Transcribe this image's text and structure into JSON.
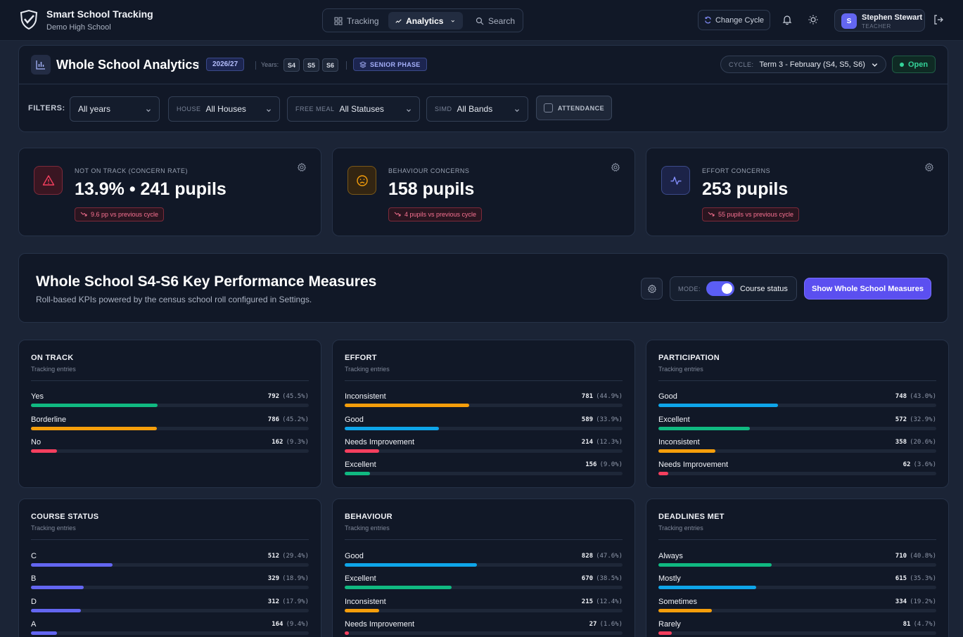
{
  "app": {
    "title": "Smart School Tracking",
    "school": "Demo High School"
  },
  "nav": {
    "tracking": "Tracking",
    "analytics": "Analytics",
    "search": "Search"
  },
  "topbar": {
    "change_cycle": "Change Cycle",
    "user_name": "Stephen Stewart",
    "user_role": "TEACHER",
    "user_initial": "S"
  },
  "header": {
    "title": "Whole School Analytics",
    "session": "2026/27",
    "years_label": "Years:",
    "years": [
      "S4",
      "S5",
      "S6"
    ],
    "phase": "SENIOR PHASE",
    "cycle_label": "CYCLE:",
    "cycle_value": "Term 3 - February (S4, S5, S6)",
    "status": "Open"
  },
  "filters": {
    "label": "FILTERS:",
    "years": {
      "value": "All years"
    },
    "house": {
      "key": "HOUSE",
      "value": "All Houses"
    },
    "free_meal": {
      "key": "FREE MEAL",
      "value": "All Statuses"
    },
    "simd": {
      "key": "SIMD",
      "value": "All Bands"
    },
    "attendance": "ATTENDANCE"
  },
  "stats": [
    {
      "label": "NOT ON TRACK (CONCERN RATE)",
      "value": "13.9% • 241 pupils",
      "delta": "9.6 pp vs previous cycle",
      "icon": "alert-triangle-icon",
      "color": "#f43f5e"
    },
    {
      "label": "BEHAVIOUR CONCERNS",
      "value": "158 pupils",
      "delta": "4 pupils vs previous cycle",
      "icon": "frown-face-icon",
      "color": "#f59e0b"
    },
    {
      "label": "EFFORT CONCERNS",
      "value": "253 pupils",
      "delta": "55 pupils vs previous cycle",
      "icon": "activity-pulse-icon",
      "color": "#818cf8"
    }
  ],
  "kpi": {
    "title": "Whole School S4-S6 Key Performance Measures",
    "subtitle": "Roll-based KPIs powered by the census school roll configured in Settings.",
    "mode_label": "MODE:",
    "mode_value": "Course status",
    "show_button": "Show Whole School Measures"
  },
  "measures": [
    {
      "title": "ON TRACK",
      "subtitle": "Tracking entries",
      "rows": [
        {
          "label": "Yes",
          "count": "792",
          "pct": "(45.5%)",
          "frac": 0.455,
          "color": "#10b981"
        },
        {
          "label": "Borderline",
          "count": "786",
          "pct": "(45.2%)",
          "frac": 0.452,
          "color": "#f59e0b"
        },
        {
          "label": "No",
          "count": "162",
          "pct": "(9.3%)",
          "frac": 0.093,
          "color": "#f43f5e"
        }
      ]
    },
    {
      "title": "EFFORT",
      "subtitle": "Tracking entries",
      "rows": [
        {
          "label": "Inconsistent",
          "count": "781",
          "pct": "(44.9%)",
          "frac": 0.449,
          "color": "#f59e0b"
        },
        {
          "label": "Good",
          "count": "589",
          "pct": "(33.9%)",
          "frac": 0.339,
          "color": "#0ea5e9"
        },
        {
          "label": "Needs Improvement",
          "count": "214",
          "pct": "(12.3%)",
          "frac": 0.123,
          "color": "#f43f5e"
        },
        {
          "label": "Excellent",
          "count": "156",
          "pct": "(9.0%)",
          "frac": 0.09,
          "color": "#10b981"
        }
      ]
    },
    {
      "title": "PARTICIPATION",
      "subtitle": "Tracking entries",
      "rows": [
        {
          "label": "Good",
          "count": "748",
          "pct": "(43.0%)",
          "frac": 0.43,
          "color": "#0ea5e9"
        },
        {
          "label": "Excellent",
          "count": "572",
          "pct": "(32.9%)",
          "frac": 0.329,
          "color": "#10b981"
        },
        {
          "label": "Inconsistent",
          "count": "358",
          "pct": "(20.6%)",
          "frac": 0.206,
          "color": "#f59e0b"
        },
        {
          "label": "Needs Improvement",
          "count": "62",
          "pct": "(3.6%)",
          "frac": 0.036,
          "color": "#f43f5e"
        }
      ]
    },
    {
      "title": "COURSE STATUS",
      "subtitle": "Tracking entries",
      "rows": [
        {
          "label": "C",
          "count": "512",
          "pct": "(29.4%)",
          "frac": 0.294,
          "color": "#6366f1"
        },
        {
          "label": "B",
          "count": "329",
          "pct": "(18.9%)",
          "frac": 0.189,
          "color": "#6366f1"
        },
        {
          "label": "D",
          "count": "312",
          "pct": "(17.9%)",
          "frac": 0.179,
          "color": "#6366f1"
        },
        {
          "label": "A",
          "count": "164",
          "pct": "(9.4%)",
          "frac": 0.094,
          "color": "#6366f1"
        }
      ]
    },
    {
      "title": "BEHAVIOUR",
      "subtitle": "Tracking entries",
      "rows": [
        {
          "label": "Good",
          "count": "828",
          "pct": "(47.6%)",
          "frac": 0.476,
          "color": "#0ea5e9"
        },
        {
          "label": "Excellent",
          "count": "670",
          "pct": "(38.5%)",
          "frac": 0.385,
          "color": "#10b981"
        },
        {
          "label": "Inconsistent",
          "count": "215",
          "pct": "(12.4%)",
          "frac": 0.124,
          "color": "#f59e0b"
        },
        {
          "label": "Needs Improvement",
          "count": "27",
          "pct": "(1.6%)",
          "frac": 0.016,
          "color": "#f43f5e"
        }
      ]
    },
    {
      "title": "DEADLINES MET",
      "subtitle": "Tracking entries",
      "rows": [
        {
          "label": "Always",
          "count": "710",
          "pct": "(40.8%)",
          "frac": 0.408,
          "color": "#10b981"
        },
        {
          "label": "Mostly",
          "count": "615",
          "pct": "(35.3%)",
          "frac": 0.353,
          "color": "#0ea5e9"
        },
        {
          "label": "Sometimes",
          "count": "334",
          "pct": "(19.2%)",
          "frac": 0.192,
          "color": "#f59e0b"
        },
        {
          "label": "Rarely",
          "count": "81",
          "pct": "(4.7%)",
          "frac": 0.047,
          "color": "#f43f5e"
        }
      ]
    }
  ]
}
